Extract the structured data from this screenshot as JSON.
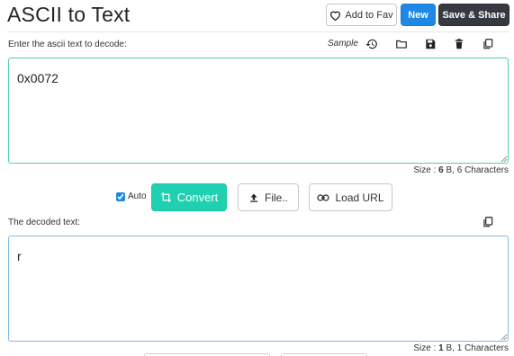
{
  "header": {
    "title": "ASCII to Text",
    "fav_label": "Add to Fav",
    "new_label": "New",
    "save_label": "Save & Share"
  },
  "input": {
    "label": "Enter the ascii text to decode:",
    "sample_label": "Sample",
    "value": "0x0072",
    "size_prefix": "Size : ",
    "size_bytes": "6",
    "size_suffix": " B, 6 Characters"
  },
  "controls": {
    "auto_label": "Auto",
    "auto_checked": true,
    "convert_label": "Convert",
    "file_label": "File..",
    "load_url_label": "Load URL"
  },
  "output": {
    "label": "The decoded text:",
    "value": "r",
    "size_prefix": "Size : ",
    "size_bytes": "1",
    "size_suffix": " B, 1 Characters"
  },
  "icons": {
    "fav": "heart-outline-icon",
    "history": "history-icon",
    "open": "folder-icon",
    "save": "floppy-icon",
    "delete": "trash-icon",
    "copy": "copy-icon",
    "convert": "crop-icon",
    "file": "upload-icon",
    "url": "link-icon"
  },
  "colors": {
    "new_button": "#1e88e5",
    "save_button": "#343a40",
    "convert_button": "#1fd1b0",
    "input_border": "#4fd1b5",
    "output_border": "#7fb8e8"
  }
}
